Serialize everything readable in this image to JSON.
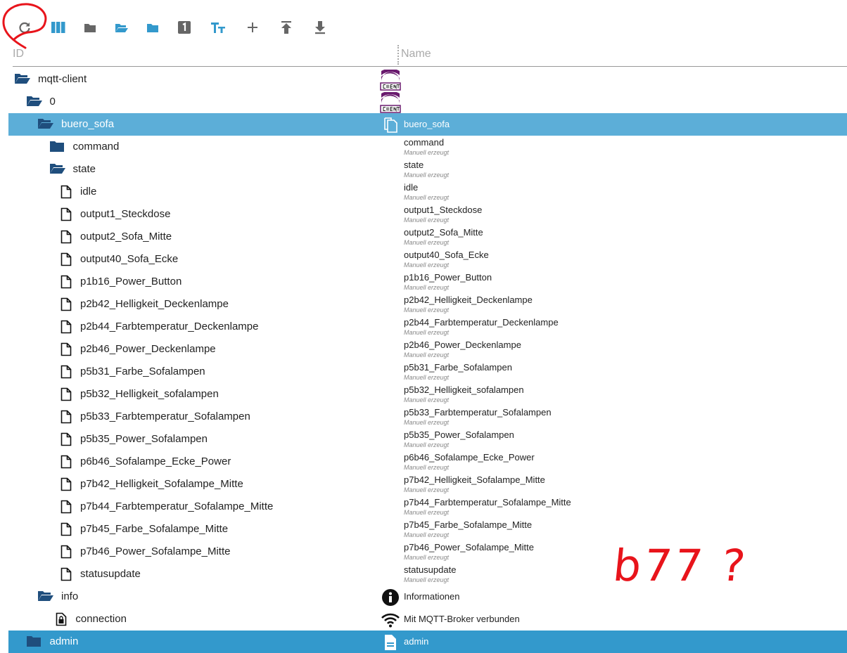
{
  "toolbar": [
    {
      "name": "refresh-button",
      "icon": "refresh-icon"
    },
    {
      "name": "columns-button",
      "icon": "columns-icon"
    },
    {
      "name": "collapse-all-button",
      "icon": "folder-icon"
    },
    {
      "name": "expand-all-button",
      "icon": "folder-open-icon"
    },
    {
      "name": "expand-level-button",
      "icon": "folder-icon"
    },
    {
      "name": "level-button",
      "icon": "number-one-icon",
      "label": "1"
    },
    {
      "name": "text-size-button",
      "icon": "text-size-icon"
    },
    {
      "name": "add-button",
      "icon": "plus-icon"
    },
    {
      "name": "upload-button",
      "icon": "upload-icon"
    },
    {
      "name": "download-button",
      "icon": "download-icon"
    }
  ],
  "header": {
    "id": "ID",
    "name": "Name"
  },
  "subtitle": "Manuell erzeugt",
  "colors": {
    "folder": "#1f4e7d",
    "selected": "#5caed8",
    "selected2": "#3399cc",
    "accent": "#3399cc",
    "annotation": "#e8141b"
  },
  "rows": [
    {
      "id": "mqtt-client",
      "level": 0,
      "type": "folder-open",
      "nameIcon": "client",
      "name": ""
    },
    {
      "id": "0",
      "level": 1,
      "type": "folder-open",
      "nameIcon": "client",
      "name": ""
    },
    {
      "id": "buero_sofa",
      "level": 2,
      "type": "folder-open",
      "nameIcon": "copy",
      "name": "buero_sofa",
      "selected": true
    },
    {
      "id": "command",
      "level": 3,
      "type": "folder",
      "name": "command",
      "sub": true
    },
    {
      "id": "state",
      "level": 3,
      "type": "folder-open",
      "name": "state",
      "sub": true
    },
    {
      "id": "idle",
      "level": 4,
      "type": "file",
      "name": "idle",
      "sub": true
    },
    {
      "id": "output1_Steckdose",
      "level": 4,
      "type": "file",
      "name": "output1_Steckdose",
      "sub": true
    },
    {
      "id": "output2_Sofa_Mitte",
      "level": 4,
      "type": "file",
      "name": "output2_Sofa_Mitte",
      "sub": true
    },
    {
      "id": "output40_Sofa_Ecke",
      "level": 4,
      "type": "file",
      "name": "output40_Sofa_Ecke",
      "sub": true
    },
    {
      "id": "p1b16_Power_Button",
      "level": 4,
      "type": "file",
      "name": "p1b16_Power_Button",
      "sub": true
    },
    {
      "id": "p2b42_Helligkeit_Deckenlampe",
      "level": 4,
      "type": "file",
      "name": "p2b42_Helligkeit_Deckenlampe",
      "sub": true
    },
    {
      "id": "p2b44_Farbtemperatur_Deckenlampe",
      "level": 4,
      "type": "file",
      "name": "p2b44_Farbtemperatur_Deckenlampe",
      "sub": true
    },
    {
      "id": "p2b46_Power_Deckenlampe",
      "level": 4,
      "type": "file",
      "name": "p2b46_Power_Deckenlampe",
      "sub": true
    },
    {
      "id": "p5b31_Farbe_Sofalampen",
      "level": 4,
      "type": "file",
      "name": "p5b31_Farbe_Sofalampen",
      "sub": true
    },
    {
      "id": "p5b32_Helligkeit_sofalampen",
      "level": 4,
      "type": "file",
      "name": "p5b32_Helligkeit_sofalampen",
      "sub": true
    },
    {
      "id": "p5b33_Farbtemperatur_Sofalampen",
      "level": 4,
      "type": "file",
      "name": "p5b33_Farbtemperatur_Sofalampen",
      "sub": true
    },
    {
      "id": "p5b35_Power_Sofalampen",
      "level": 4,
      "type": "file",
      "name": "p5b35_Power_Sofalampen",
      "sub": true
    },
    {
      "id": "p6b46_Sofalampe_Ecke_Power",
      "level": 4,
      "type": "file",
      "name": "p6b46_Sofalampe_Ecke_Power",
      "sub": true
    },
    {
      "id": "p7b42_Helligkeit_Sofalampe_Mitte",
      "level": 4,
      "type": "file",
      "name": "p7b42_Helligkeit_Sofalampe_Mitte",
      "sub": true
    },
    {
      "id": "p7b44_Farbtemperatur_Sofalampe_Mitte",
      "level": 4,
      "type": "file",
      "name": "p7b44_Farbtemperatur_Sofalampe_Mitte",
      "sub": true
    },
    {
      "id": "p7b45_Farbe_Sofalampe_Mitte",
      "level": 4,
      "type": "file",
      "name": "p7b45_Farbe_Sofalampe_Mitte",
      "sub": true
    },
    {
      "id": "p7b46_Power_Sofalampe_Mitte",
      "level": 4,
      "type": "file",
      "name": "p7b46_Power_Sofalampe_Mitte",
      "sub": true
    },
    {
      "id": "statusupdate",
      "level": 4,
      "type": "file",
      "name": "statusupdate",
      "sub": true
    },
    {
      "id": "info",
      "level": 2,
      "type": "folder-open",
      "nameIcon": "info",
      "name": "Informationen"
    },
    {
      "id": "connection",
      "level": 3.6,
      "type": "lock",
      "nameIcon": "wifi",
      "name": "Mit MQTT-Broker verbunden"
    },
    {
      "id": "admin",
      "level": 1,
      "type": "folder",
      "nameIcon": "doc",
      "name": "admin",
      "selected2": true
    }
  ],
  "annotation": {
    "text": "b77 ?"
  }
}
